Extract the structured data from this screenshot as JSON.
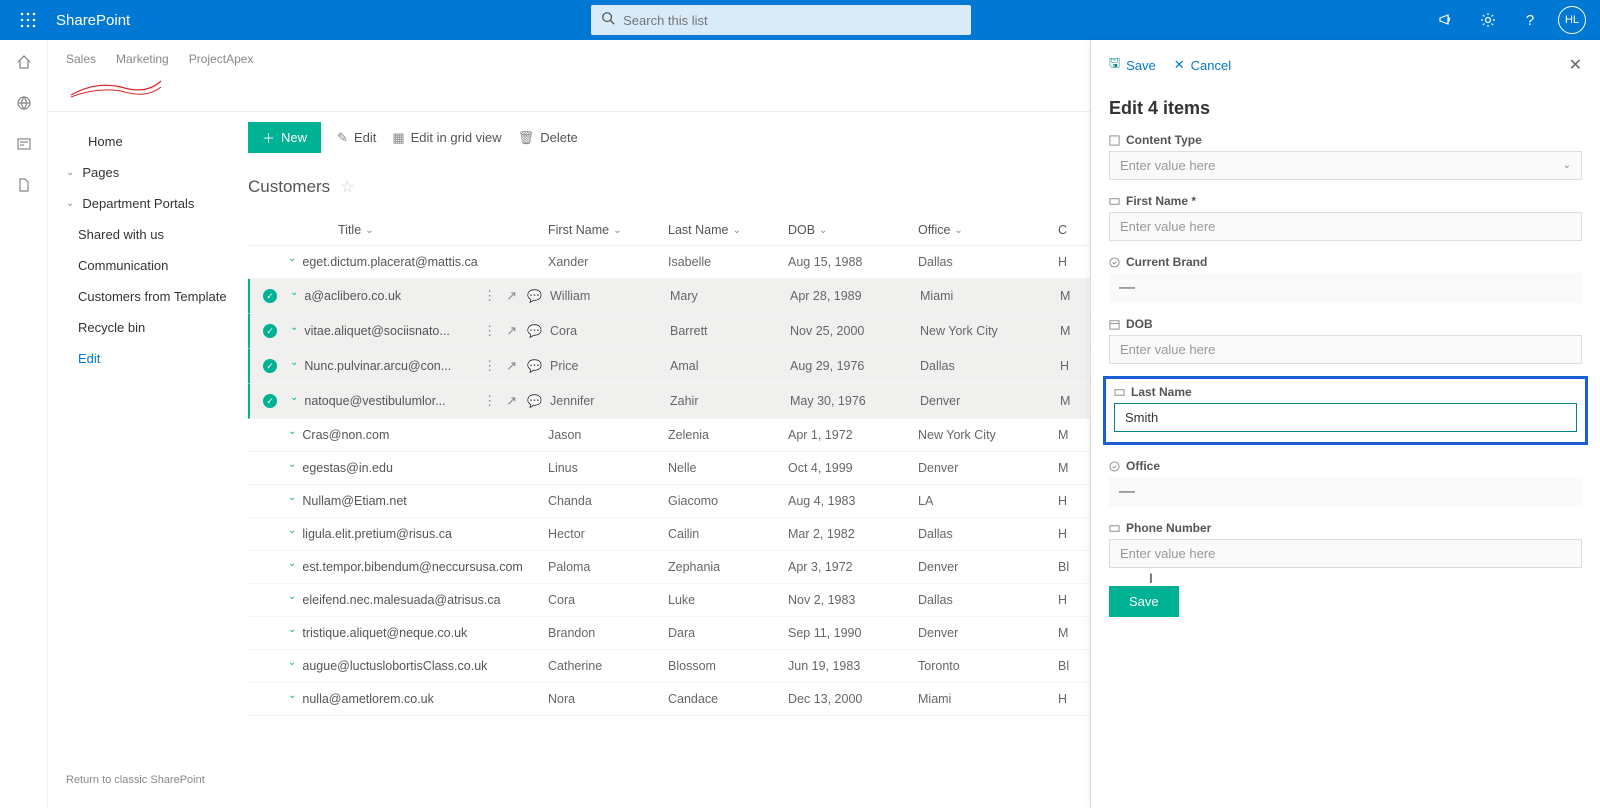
{
  "suite": {
    "app": "SharePoint",
    "search_placeholder": "Search this list",
    "avatar": "HL"
  },
  "site_nav": [
    "Sales",
    "Marketing",
    "ProjectApex"
  ],
  "left_nav": {
    "home": "Home",
    "pages": "Pages",
    "dept": "Department Portals",
    "items": [
      "Shared with us",
      "Communication",
      "Customers from Template",
      "Recycle bin"
    ],
    "edit": "Edit",
    "classic": "Return to classic SharePoint"
  },
  "cmd": {
    "new": "New",
    "edit": "Edit",
    "grid": "Edit in grid view",
    "delete": "Delete"
  },
  "list_title": "Customers",
  "columns": {
    "title": "Title",
    "first": "First Name",
    "last": "Last Name",
    "dob": "DOB",
    "office": "Office"
  },
  "rows": [
    {
      "sel": false,
      "title": "eget.dictum.placerat@mattis.ca",
      "first": "Xander",
      "last": "Isabelle",
      "dob": "Aug 15, 1988",
      "office": "Dallas",
      "r": "H"
    },
    {
      "sel": true,
      "title": "a@aclibero.co.uk",
      "first": "William",
      "last": "Mary",
      "dob": "Apr 28, 1989",
      "office": "Miami",
      "r": "M"
    },
    {
      "sel": true,
      "title": "vitae.aliquet@sociisnato...",
      "first": "Cora",
      "last": "Barrett",
      "dob": "Nov 25, 2000",
      "office": "New York City",
      "r": "M"
    },
    {
      "sel": true,
      "title": "Nunc.pulvinar.arcu@con...",
      "first": "Price",
      "last": "Amal",
      "dob": "Aug 29, 1976",
      "office": "Dallas",
      "r": "H"
    },
    {
      "sel": true,
      "title": "natoque@vestibulumlor...",
      "first": "Jennifer",
      "last": "Zahir",
      "dob": "May 30, 1976",
      "office": "Denver",
      "r": "M"
    },
    {
      "sel": false,
      "title": "Cras@non.com",
      "first": "Jason",
      "last": "Zelenia",
      "dob": "Apr 1, 1972",
      "office": "New York City",
      "r": "M"
    },
    {
      "sel": false,
      "title": "egestas@in.edu",
      "first": "Linus",
      "last": "Nelle",
      "dob": "Oct 4, 1999",
      "office": "Denver",
      "r": "M"
    },
    {
      "sel": false,
      "title": "Nullam@Etiam.net",
      "first": "Chanda",
      "last": "Giacomo",
      "dob": "Aug 4, 1983",
      "office": "LA",
      "r": "H"
    },
    {
      "sel": false,
      "title": "ligula.elit.pretium@risus.ca",
      "first": "Hector",
      "last": "Cailin",
      "dob": "Mar 2, 1982",
      "office": "Dallas",
      "r": "H"
    },
    {
      "sel": false,
      "title": "est.tempor.bibendum@neccursusa.com",
      "first": "Paloma",
      "last": "Zephania",
      "dob": "Apr 3, 1972",
      "office": "Denver",
      "r": "Bl"
    },
    {
      "sel": false,
      "title": "eleifend.nec.malesuada@atrisus.ca",
      "first": "Cora",
      "last": "Luke",
      "dob": "Nov 2, 1983",
      "office": "Dallas",
      "r": "H"
    },
    {
      "sel": false,
      "title": "tristique.aliquet@neque.co.uk",
      "first": "Brandon",
      "last": "Dara",
      "dob": "Sep 11, 1990",
      "office": "Denver",
      "r": "M"
    },
    {
      "sel": false,
      "title": "augue@luctuslobortisClass.co.uk",
      "first": "Catherine",
      "last": "Blossom",
      "dob": "Jun 19, 1983",
      "office": "Toronto",
      "r": "Bl"
    },
    {
      "sel": false,
      "title": "nulla@ametlorem.co.uk",
      "first": "Nora",
      "last": "Candace",
      "dob": "Dec 13, 2000",
      "office": "Miami",
      "r": "H"
    }
  ],
  "panel": {
    "save_cmd": "Save",
    "cancel_cmd": "Cancel",
    "title": "Edit 4 items",
    "content_type_label": "Content Type",
    "content_type_ph": "Enter value here",
    "first_name_label": "First Name *",
    "first_name_ph": "Enter value here",
    "brand_label": "Current Brand",
    "brand_val": "—",
    "dob_label": "DOB",
    "dob_ph": "Enter value here",
    "last_name_label": "Last Name",
    "last_name_val": "Smith",
    "office_label": "Office",
    "office_val": "—",
    "phone_label": "Phone Number",
    "phone_ph": "Enter value here",
    "save_btn": "Save"
  }
}
